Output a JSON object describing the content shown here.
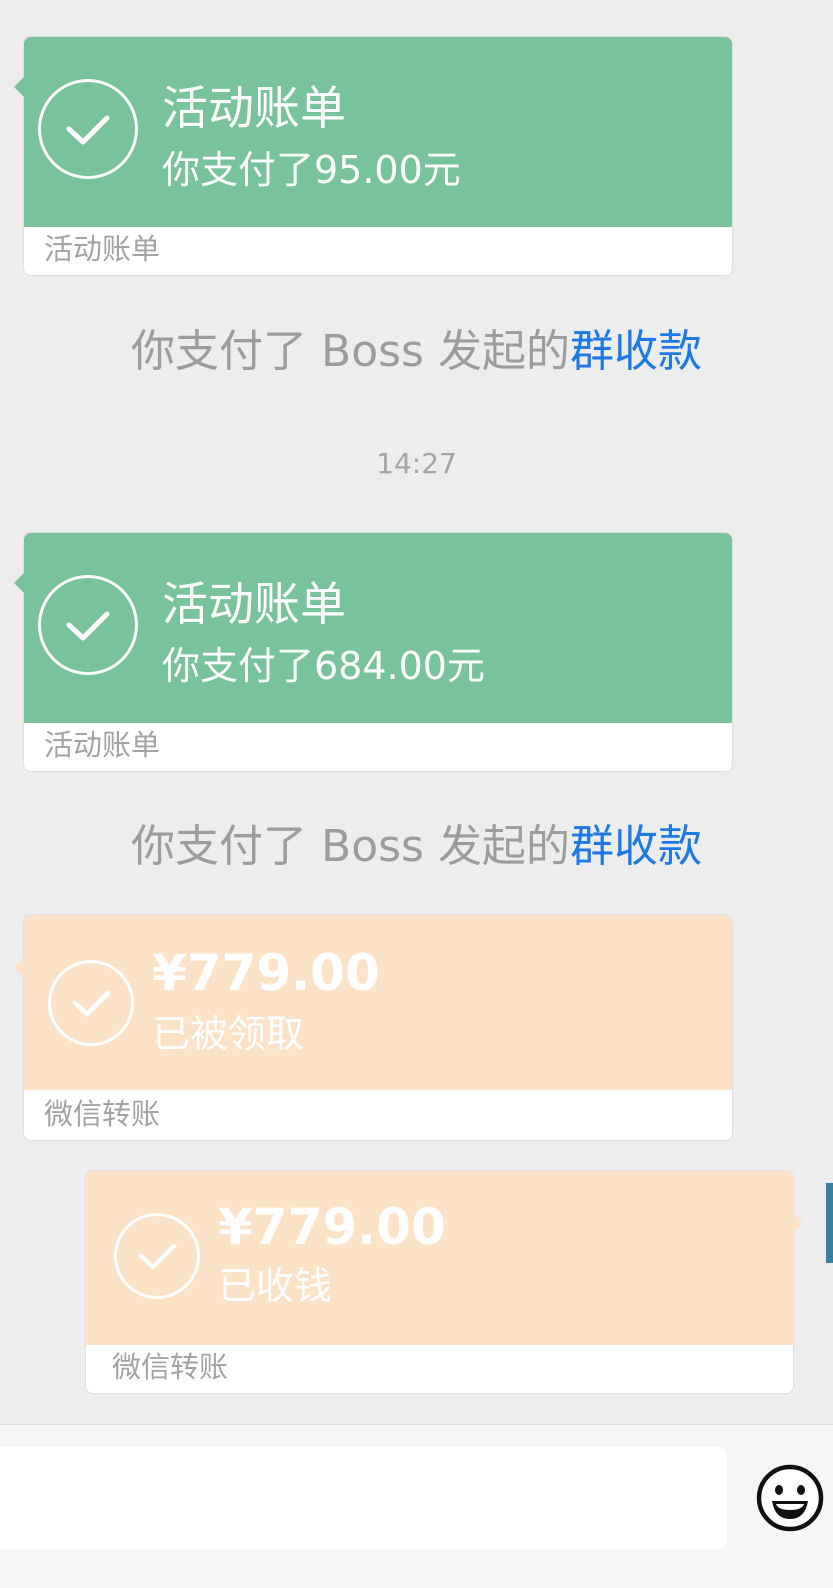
{
  "messages": [
    {
      "id": "bill-1",
      "type": "activity_bill",
      "title": "活动账单",
      "subtitle": "你支付了95.00元",
      "footer": "活动账单"
    },
    {
      "id": "notice-1",
      "type": "system_notice",
      "text": "你支付了 Boss 发起的",
      "link": "群收款"
    },
    {
      "id": "time-1",
      "type": "timestamp",
      "text": "14:27"
    },
    {
      "id": "bill-2",
      "type": "activity_bill",
      "title": "活动账单",
      "subtitle": "你支付了684.00元",
      "footer": "活动账单"
    },
    {
      "id": "notice-2",
      "type": "system_notice",
      "text": "你支付了 Boss 发起的",
      "link": "群收款"
    },
    {
      "id": "transfer-1",
      "type": "wechat_transfer",
      "amount": "¥779.00",
      "status": "已被领取",
      "footer": "微信转账"
    },
    {
      "id": "transfer-2",
      "type": "wechat_transfer",
      "amount": "¥779.00",
      "status": "已收钱",
      "footer": "微信转账"
    }
  ],
  "input_bar": {
    "placeholder": "",
    "emoji_icon": "smiley-face-icon"
  },
  "colors": {
    "background": "#ededed",
    "bill_green": "#78c39b",
    "transfer_orange": "#fce2c7",
    "link_blue": "#1e79e6",
    "notice_gray": "#9c9c9c"
  }
}
